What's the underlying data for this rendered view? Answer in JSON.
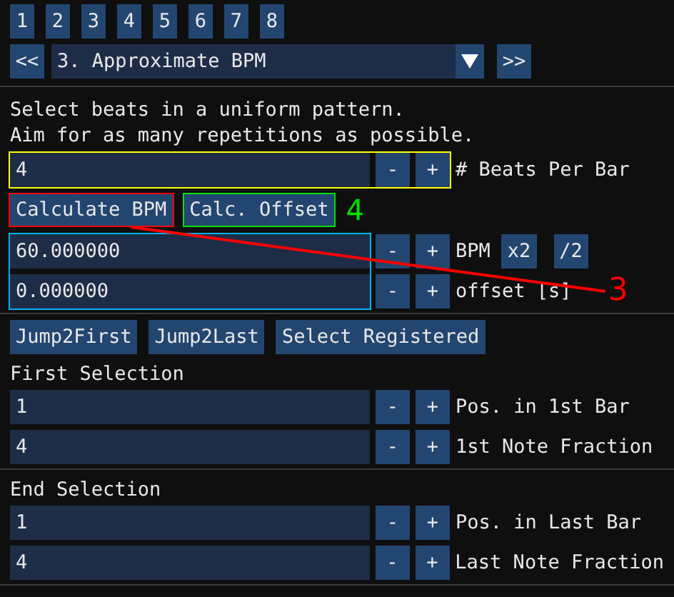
{
  "step_buttons": [
    "1",
    "2",
    "3",
    "4",
    "5",
    "6",
    "7",
    "8"
  ],
  "step_selector": {
    "prev": "<<",
    "value": "3. Approximate BPM",
    "next": ">>"
  },
  "instructions": [
    "Select beats in a uniform pattern.",
    "Aim for as many repetitions as possible."
  ],
  "beats_per_bar": {
    "value": "4",
    "minus": "-",
    "plus": "+",
    "label": "# Beats Per Bar",
    "color": "#ffff00"
  },
  "calc_buttons": [
    {
      "label": "Calculate BPM",
      "color": "#ff0000"
    },
    {
      "label": "Calc. Offset",
      "color": "#00e000",
      "note": {
        "text": "4",
        "color": "#00e000"
      }
    }
  ],
  "timing": {
    "color": "#00b4f0",
    "fields": [
      {
        "value": "60.000000",
        "minus": "-",
        "plus": "+",
        "label": "BPM",
        "extra": [
          "x2",
          "/2"
        ]
      },
      {
        "value": "0.000000",
        "minus": "-",
        "plus": "+",
        "label": "offset [s]"
      }
    ]
  },
  "callout": {
    "label": "3",
    "color": "#ff0000"
  },
  "jump_buttons": [
    "Jump2First",
    "Jump2Last",
    "Select Registered"
  ],
  "sections": [
    {
      "title": "First Selection",
      "fields": [
        {
          "value": "1",
          "minus": "-",
          "plus": "+",
          "label": "Pos. in 1st Bar"
        },
        {
          "value": "4",
          "minus": "-",
          "plus": "+",
          "label": "1st Note Fraction"
        }
      ]
    },
    {
      "title": "End Selection",
      "fields": [
        {
          "value": "1",
          "minus": "-",
          "plus": "+",
          "label": "Pos. in Last Bar"
        },
        {
          "value": "4",
          "minus": "-",
          "plus": "+",
          "label": "Last Note Fraction"
        }
      ]
    }
  ]
}
